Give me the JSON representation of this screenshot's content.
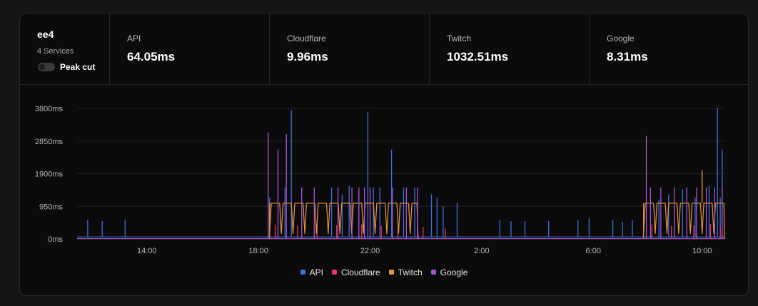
{
  "monitor": {
    "name": "ee4",
    "services_label": "4 Services",
    "peak_cut_label": "Peak cut",
    "peak_cut_enabled": false
  },
  "stats": [
    {
      "label": "API",
      "value": "64.05ms"
    },
    {
      "label": "Cloudflare",
      "value": "9.96ms"
    },
    {
      "label": "Twitch",
      "value": "1032.51ms"
    },
    {
      "label": "Google",
      "value": "8.31ms"
    }
  ],
  "chart_data": {
    "type": "line",
    "x_unit": "hours since 11:30",
    "xlim": [
      0,
      23.2
    ],
    "ylim": [
      0,
      3800
    ],
    "y_ticks": [
      "0ms",
      "950ms",
      "1900ms",
      "2850ms",
      "3800ms"
    ],
    "x_ticks": [
      {
        "label": "14:00",
        "x": 2.5
      },
      {
        "label": "18:00",
        "x": 6.5
      },
      {
        "label": "22:00",
        "x": 10.5
      },
      {
        "label": "2:00",
        "x": 14.5
      },
      {
        "label": "6:00",
        "x": 18.5
      },
      {
        "label": "10:00",
        "x": 22.4
      }
    ],
    "grid": true,
    "legend_position": "bottom",
    "series": [
      {
        "name": "API",
        "color": "#3b6fe0",
        "baseline": 60,
        "spikes": [
          [
            0.38,
            550
          ],
          [
            0.9,
            520
          ],
          [
            1.72,
            560
          ],
          [
            6.9,
            1200
          ],
          [
            7.45,
            1500
          ],
          [
            7.68,
            3750
          ],
          [
            9.12,
            1500
          ],
          [
            9.5,
            1300
          ],
          [
            9.75,
            1550
          ],
          [
            10.1,
            1400
          ],
          [
            10.42,
            3700
          ],
          [
            10.62,
            1500
          ],
          [
            10.85,
            1500
          ],
          [
            11.27,
            2600
          ],
          [
            11.7,
            1500
          ],
          [
            12.1,
            1500
          ],
          [
            12.7,
            1300
          ],
          [
            12.9,
            1200
          ],
          [
            13.12,
            950
          ],
          [
            13.62,
            1050
          ],
          [
            15.15,
            550
          ],
          [
            15.55,
            520
          ],
          [
            16.05,
            520
          ],
          [
            16.9,
            520
          ],
          [
            17.95,
            550
          ],
          [
            18.35,
            600
          ],
          [
            19.2,
            560
          ],
          [
            19.55,
            500
          ],
          [
            19.9,
            550
          ],
          [
            20.3,
            560
          ],
          [
            20.85,
            1150
          ],
          [
            21.2,
            1300
          ],
          [
            21.7,
            1450
          ],
          [
            22.15,
            1200
          ],
          [
            22.65,
            1550
          ],
          [
            22.95,
            3800
          ],
          [
            23.05,
            1200
          ],
          [
            23.12,
            2600
          ]
        ]
      },
      {
        "name": "Cloudflare",
        "color": "#e8336d",
        "baseline": 10,
        "spikes": [
          [
            7.1,
            420
          ],
          [
            7.9,
            380
          ],
          [
            8.6,
            460
          ],
          [
            9.3,
            400
          ],
          [
            10.2,
            420
          ],
          [
            10.9,
            380
          ],
          [
            11.5,
            300
          ],
          [
            12.4,
            350
          ],
          [
            13.2,
            300
          ],
          [
            20.6,
            420
          ],
          [
            21.3,
            380
          ],
          [
            22.1,
            400
          ],
          [
            22.7,
            430
          ],
          [
            23.05,
            350
          ]
        ]
      },
      {
        "name": "Twitch",
        "color": "#e9963b",
        "baseline": 1040,
        "segments": [
          [
            6.9,
            12.22
          ],
          [
            20.3,
            23.2
          ]
        ],
        "spikes": [
          [
            22.4,
            2000
          ]
        ]
      },
      {
        "name": "Google",
        "color": "#a453d8",
        "baseline": 8,
        "spikes": [
          [
            6.85,
            3100
          ],
          [
            7.2,
            2600
          ],
          [
            7.5,
            3050
          ],
          [
            8.05,
            1500
          ],
          [
            8.5,
            1500
          ],
          [
            9.35,
            1500
          ],
          [
            9.85,
            1500
          ],
          [
            10.1,
            1500
          ],
          [
            10.3,
            1500
          ],
          [
            10.5,
            1500
          ],
          [
            11.3,
            1500
          ],
          [
            11.8,
            1500
          ],
          [
            12.2,
            1500
          ],
          [
            20.4,
            3000
          ],
          [
            20.55,
            1500
          ],
          [
            20.92,
            1500
          ],
          [
            21.4,
            1500
          ],
          [
            21.85,
            1500
          ],
          [
            22.2,
            1500
          ],
          [
            22.55,
            1500
          ],
          [
            22.85,
            1500
          ],
          [
            23.12,
            1500
          ]
        ]
      }
    ]
  }
}
